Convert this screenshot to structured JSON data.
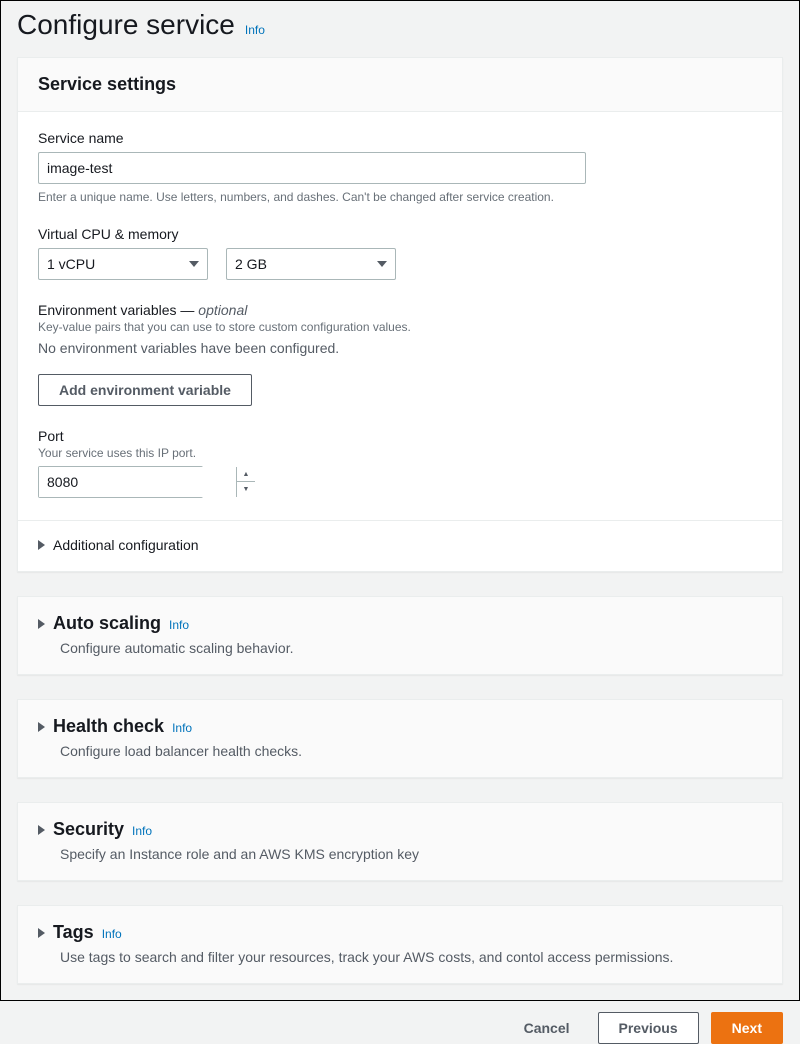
{
  "page": {
    "title": "Configure service",
    "info_label": "Info"
  },
  "service_settings": {
    "header": "Service settings",
    "service_name": {
      "label": "Service name",
      "value": "image-test",
      "hint": "Enter a unique name. Use letters, numbers, and dashes. Can't be changed after service creation."
    },
    "cpu_memory": {
      "label": "Virtual CPU & memory",
      "cpu_value": "1 vCPU",
      "memory_value": "2 GB"
    },
    "env_vars": {
      "label": "Environment variables —",
      "optional_text": "optional",
      "hint": "Key-value pairs that you can use to store custom configuration values.",
      "empty_text": "No environment variables have been configured.",
      "add_button": "Add environment variable"
    },
    "port": {
      "label": "Port",
      "hint": "Your service uses this IP port.",
      "value": "8080"
    },
    "additional_config": "Additional configuration"
  },
  "auto_scaling": {
    "title": "Auto scaling",
    "info": "Info",
    "description": "Configure automatic scaling behavior."
  },
  "health_check": {
    "title": "Health check",
    "info": "Info",
    "description": "Configure load balancer health checks."
  },
  "security": {
    "title": "Security",
    "info": "Info",
    "description": "Specify an Instance role and an AWS KMS encryption key"
  },
  "tags": {
    "title": "Tags",
    "info": "Info",
    "description": "Use tags to search and filter your resources, track your AWS costs, and contol access permissions."
  },
  "footer": {
    "cancel": "Cancel",
    "previous": "Previous",
    "next": "Next"
  }
}
